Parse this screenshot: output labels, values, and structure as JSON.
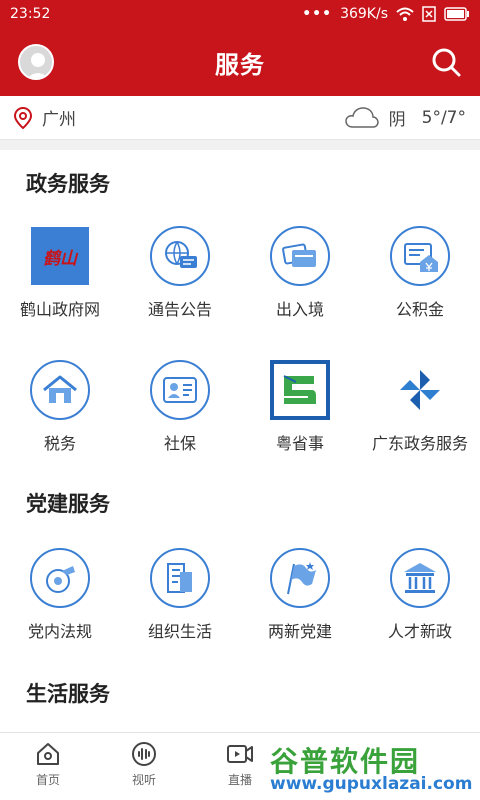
{
  "status_bar": {
    "time": "23:52",
    "dots": "•••",
    "network_speed": "369K/s"
  },
  "header": {
    "title": "服务"
  },
  "weather": {
    "city": "广州",
    "condition": "阴",
    "temperature": "5°/7°"
  },
  "sections": [
    {
      "title": "政务服务",
      "rows": [
        [
          {
            "label": "鹤山政府网",
            "icon": "heshan-gov-logo",
            "logo_text": "鹤山"
          },
          {
            "label": "通告公告",
            "icon": "globe-message-icon"
          },
          {
            "label": "出入境",
            "icon": "passport-cards-icon"
          },
          {
            "label": "公积金",
            "icon": "housing-fund-icon"
          }
        ],
        [
          {
            "label": "税务",
            "icon": "house-tax-icon"
          },
          {
            "label": "社保",
            "icon": "id-card-icon"
          },
          {
            "label": "粤省事",
            "icon": "yueshengshi-logo"
          },
          {
            "label": "广东政务服务",
            "icon": "pinwheel-logo"
          }
        ]
      ]
    },
    {
      "title": "党建服务",
      "rows": [
        [
          {
            "label": "党内法规",
            "icon": "whistle-icon"
          },
          {
            "label": "组织生活",
            "icon": "building-icon"
          },
          {
            "label": "两新党建",
            "icon": "flag-icon"
          },
          {
            "label": "人才新政",
            "icon": "institution-icon"
          }
        ]
      ]
    },
    {
      "title": "生活服务",
      "rows": []
    }
  ],
  "bottom_nav": [
    {
      "label": "首页",
      "icon": "home-icon"
    },
    {
      "label": "视听",
      "icon": "audio-icon"
    },
    {
      "label": "直播",
      "icon": "video-icon"
    }
  ],
  "watermark": {
    "line1": "谷普软件园",
    "line2": "www.gupuxlazai.com"
  },
  "colors": {
    "brand_red": "#c8141b",
    "icon_blue": "#3b7fd4"
  }
}
